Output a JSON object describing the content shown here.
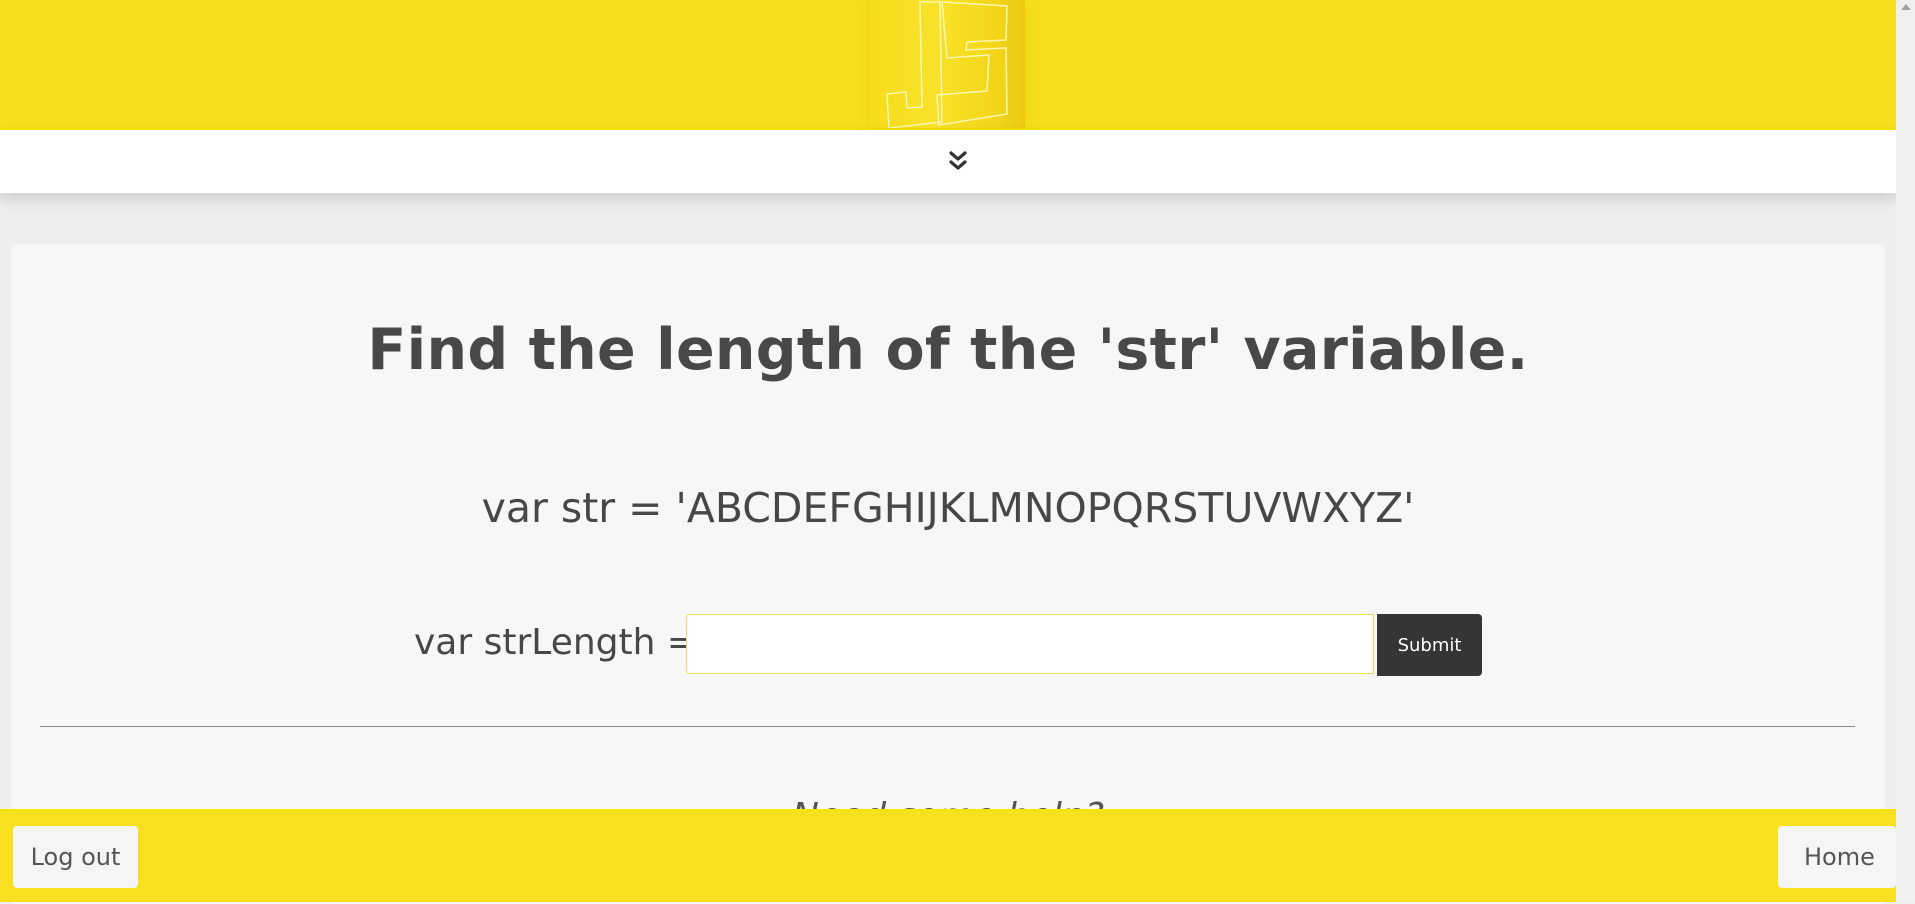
{
  "header": {
    "logo_text": "JS",
    "expand_icon": "double-chevron-down-icon"
  },
  "question": {
    "title": "Find the length of the 'str' variable.",
    "code": "var str = 'ABCDEFGHIJKLMNOPQRSTUVWXYZ'"
  },
  "answer": {
    "label": "var strLength =",
    "value": "",
    "placeholder": "",
    "submit_label": "Submit"
  },
  "help": {
    "text": "Need some help?"
  },
  "footer": {
    "logout_label": "Log out",
    "home_label": "Home"
  },
  "colors": {
    "brand_yellow": "#f6df20",
    "button_dark": "#353535",
    "card_background": "#f7f7f7"
  }
}
